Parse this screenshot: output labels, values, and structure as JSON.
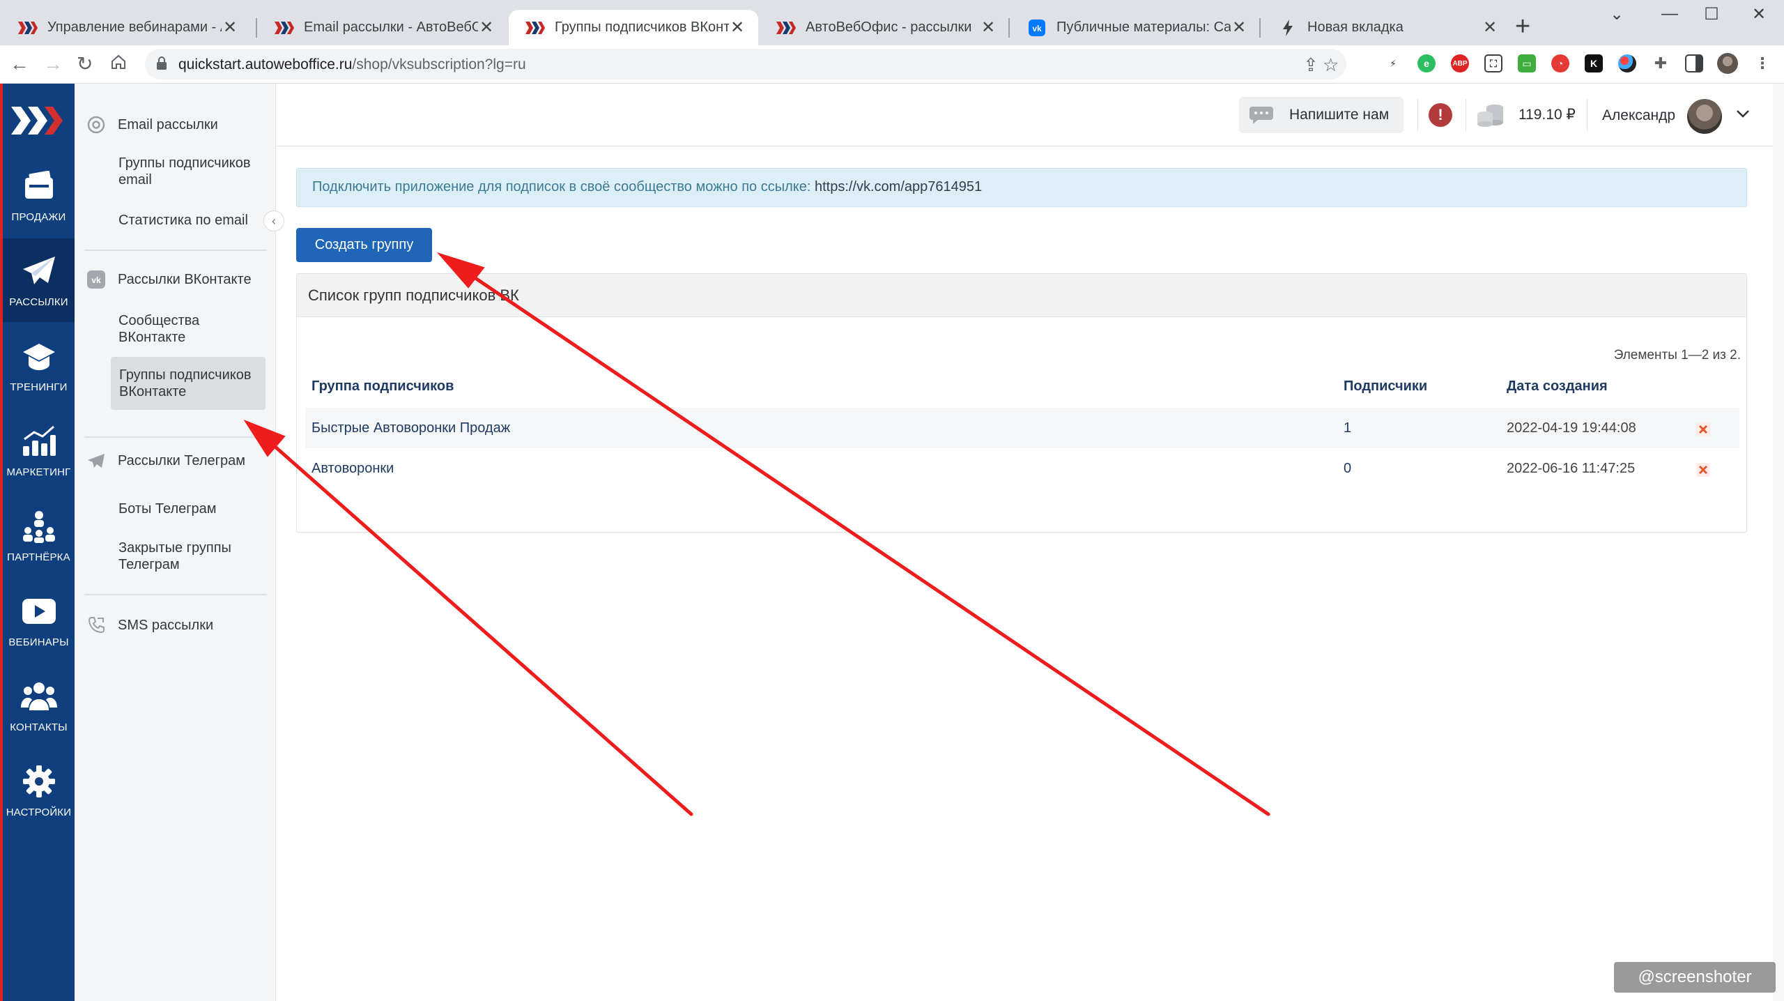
{
  "browser": {
    "tabs": [
      {
        "title": "Управление вебинарами - Авто",
        "favicon": "autoweboffice-logo",
        "active": false
      },
      {
        "title": "Email рассылки - АвтоВебОфис",
        "favicon": "autoweboffice-logo",
        "active": false
      },
      {
        "title": "Группы подписчиков ВКонтакте",
        "favicon": "autoweboffice-logo",
        "active": true
      },
      {
        "title": "АвтоВебОфис - рассылки",
        "favicon": "autoweboffice-logo",
        "active": false
      },
      {
        "title": "Публичные материалы: Callbac",
        "favicon": "vk-logo",
        "active": false
      },
      {
        "title": "Новая вкладка",
        "favicon": "bolt-icon",
        "active": false
      }
    ],
    "new_tab": "+",
    "url_host": "quickstart.autoweboffice.ru",
    "url_path": "/shop/vksubscription?lg=ru",
    "extensions": [
      "bolt",
      "evernote",
      "ABP",
      "screenshot",
      "green-ext",
      "red-ext",
      "K",
      "colors",
      "puzzle",
      "sidebar"
    ]
  },
  "iconbar": {
    "items": [
      {
        "label": "ПРОДАЖИ",
        "icon": "wallet-icon",
        "active": false
      },
      {
        "label": "РАССЫЛКИ",
        "icon": "paper-plane-icon",
        "active": true
      },
      {
        "label": "ТРЕНИНГИ",
        "icon": "graduation-cap-icon",
        "active": false
      },
      {
        "label": "МАРКЕТИНГ",
        "icon": "bar-chart-icon",
        "active": false
      },
      {
        "label": "ПАРТНЁРКА",
        "icon": "partners-icon",
        "active": false
      },
      {
        "label": "ВЕБИНАРЫ",
        "icon": "play-icon",
        "active": false
      },
      {
        "label": "КОНТАКТЫ",
        "icon": "contacts-icon",
        "active": false
      },
      {
        "label": "НАСТРОЙКИ",
        "icon": "gear-icon",
        "active": false
      }
    ]
  },
  "sidebar": {
    "email_head": "Email рассылки",
    "email_items": [
      "Группы подписчиков email",
      "Статистика по email"
    ],
    "vk_head": "Рассылки ВКонтакте",
    "vk_items": [
      "Сообщества ВКонтакте",
      "Группы подписчиков ВКонтакте"
    ],
    "tg_head": "Рассылки Телеграм",
    "tg_items": [
      "Боты Телеграм",
      "Закрытые группы Телеграм"
    ],
    "sms_head": "SMS рассылки"
  },
  "header": {
    "write_us": "Напишите нам",
    "balance": "119.10 ₽",
    "user": "Александр"
  },
  "main": {
    "info_text": "Подключить приложение для подписок в своё сообщество можно по ссылке: ",
    "info_link": "https://vk.com/app7614951",
    "create_button": "Создать группу",
    "panel_title": "Список групп подписчиков ВК",
    "pager": "Элементы 1—2 из 2.",
    "columns": [
      "Группа подписчиков",
      "Подписчики",
      "Дата создания"
    ],
    "rows": [
      {
        "name": "Быстрые Автоворонки Продаж",
        "subscribers": "1",
        "created": "2022-04-19 19:44:08"
      },
      {
        "name": "Автоворонки",
        "subscribers": "0",
        "created": "2022-06-16 11:47:25"
      }
    ]
  },
  "watermark": "@screenshoter",
  "colors": {
    "iconbar_bg": "#0f3f7f",
    "primary_button": "#1f66b8",
    "annotation_arrow": "#ee1c1c"
  }
}
